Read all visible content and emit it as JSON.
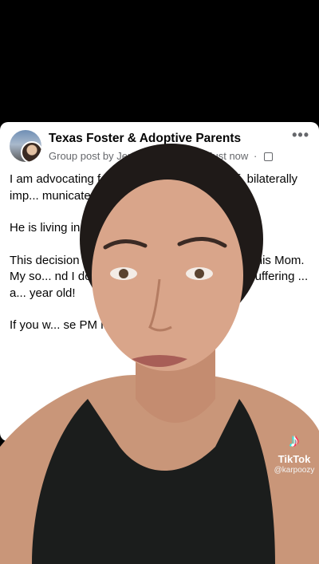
{
  "post": {
    "group_name": "Texas Foster & Adoptive Parents",
    "meta_prefix": "Group post by",
    "author": "Jennifer Ruppert",
    "separator": "·",
    "time": "Just now",
    "more_label": "•••",
    "paragraphs": [
      "I am advocating for a ... old boy who is deaf, bilaterally imp... municates in ASL.",
      "He is living in t... nally adopted at ag...",
      "This decision ... ly. They reached out t... come his Mom. My so... nd I do not feel I can cur... thout one suffering ... a... year old!",
      "If you w... se PM me."
    ]
  },
  "watermark": {
    "logo": "♪",
    "brand": "TikTok",
    "handle": "@karpoozy"
  },
  "colors": {
    "background": "#000000",
    "card": "#ffffff",
    "meta_text": "#65676b",
    "skin": "#d9a58a",
    "hair": "#1f1a18",
    "tank_top": "#1b1d1c"
  }
}
